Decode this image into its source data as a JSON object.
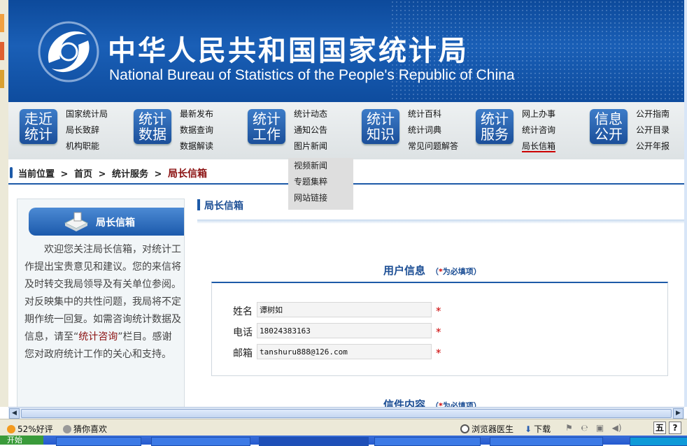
{
  "header": {
    "title_cn": "中华人民共和国国家统计局",
    "title_en": "National Bureau of Statistics of the People's Republic of China"
  },
  "nav": [
    {
      "box": [
        "走近",
        "统计"
      ],
      "links": [
        "国家统计局",
        "局长致辞",
        "机构职能"
      ]
    },
    {
      "box": [
        "统计",
        "数据"
      ],
      "links": [
        "最新发布",
        "数据查询",
        "数据解读"
      ]
    },
    {
      "box": [
        "统计",
        "工作"
      ],
      "links": [
        "统计动态",
        "通知公告",
        "图片新闻"
      ]
    },
    {
      "box": [
        "统计",
        "知识"
      ],
      "links": [
        "统计百科",
        "统计词典",
        "常见问题解答"
      ]
    },
    {
      "box": [
        "统计",
        "服务"
      ],
      "links": [
        "网上办事",
        "统计咨询",
        "局长信箱"
      ]
    },
    {
      "box": [
        "信息",
        "公开"
      ],
      "links": [
        "公开指南",
        "公开目录",
        "公开年报"
      ]
    }
  ],
  "dropdown": [
    "视频新闻",
    "专题集粹",
    "网站链接"
  ],
  "breadcrumb": {
    "label": "当前位置",
    "items": [
      "首页",
      "统计服务"
    ],
    "current": "局长信箱",
    "separator": ">"
  },
  "left_panel": {
    "title": "局长信箱",
    "text_before": "欢迎您关注局长信箱，对统计工作提出宝贵意见和建议。您的来信将及时转交我局领导及有关单位参阅。对反映集中的共性问题，我局将不定期作统一回复。如需咨询统计数据及信息，请至“",
    "link": "统计咨询",
    "text_after": "”栏目。感谢您对政府统计工作的关心和支持。"
  },
  "main": {
    "title": "局长信箱",
    "user_section": {
      "title": "用户信息",
      "required_note_prefix": "（",
      "required_star": "*",
      "required_note": "为必填项）"
    },
    "fields": [
      {
        "label": "姓名",
        "value": "谭树如",
        "mark": "*"
      },
      {
        "label": "电话",
        "value": "18024383163",
        "mark": "*"
      },
      {
        "label": "邮箱",
        "value": "tanshuru888@126.com",
        "mark": "*"
      }
    ],
    "letter_section": {
      "title": "信件内容",
      "required_note_prefix": "（",
      "required_star": "*",
      "required_note": "为必填项）"
    }
  },
  "statusbar": {
    "rating": "52%好评",
    "guess": "猜你喜欢",
    "doctor": "浏览器医生",
    "download": "下载",
    "ime": "五",
    "help": "?"
  },
  "taskbar": {
    "start": "开始"
  },
  "colors": {
    "brand_blue": "#1d5aa8",
    "accent_red": "#8b1010",
    "required_red": "#cc0000"
  }
}
